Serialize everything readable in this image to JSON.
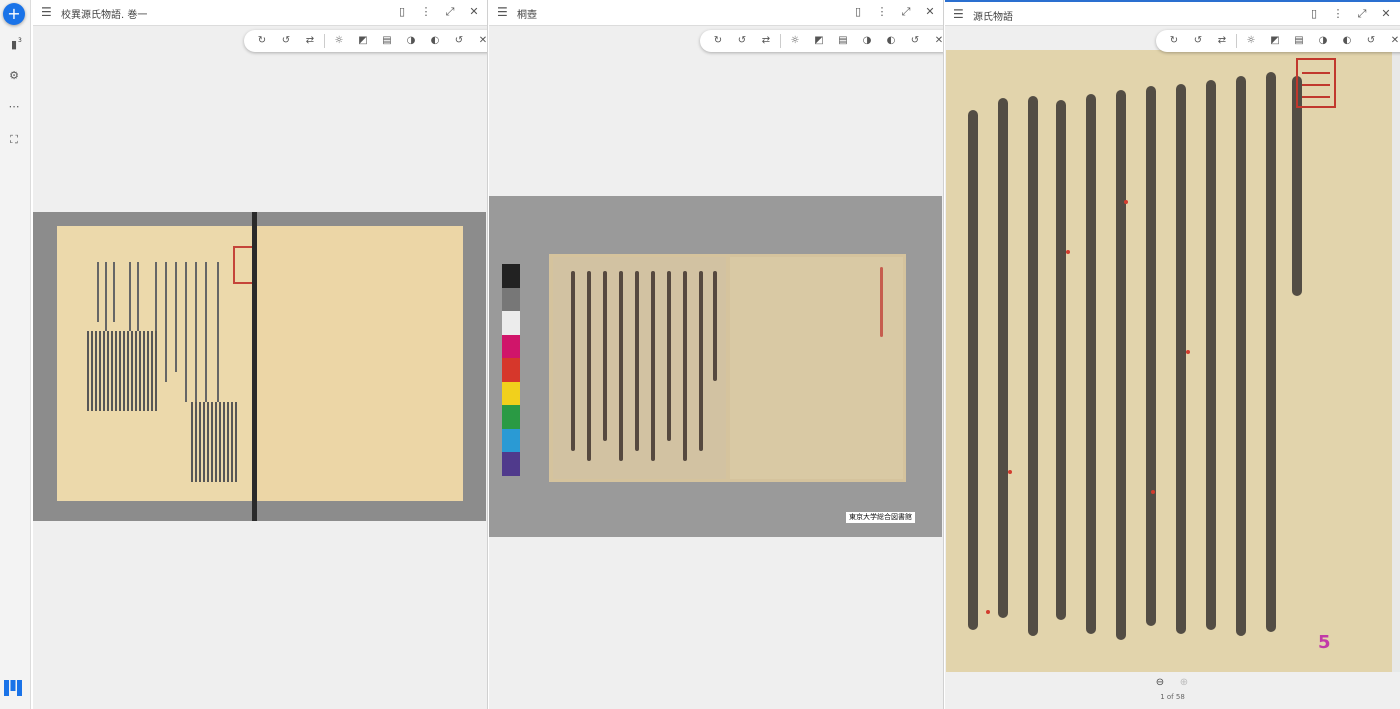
{
  "rail": {
    "add_label": "+",
    "window_count": "3"
  },
  "windows": [
    {
      "title": "校異源氏物語. 巻一",
      "toolbar": [
        "rotate-cw-icon",
        "rotate-ccw-icon",
        "flip-icon",
        "brightness-icon",
        "contrast-icon",
        "saturation-icon",
        "grayscale-icon",
        "invert-icon",
        "reset-icon",
        "close-icon"
      ]
    },
    {
      "title": "桐壺",
      "caption": "東京大学総合図書館"
    },
    {
      "title": "源氏物語",
      "page_number": "5",
      "page_indicator": "1 of 58"
    }
  ],
  "colors": {
    "accent": "#1a73e8",
    "focus_border": "#2a6fd0",
    "seal_red": "#c1382d"
  }
}
